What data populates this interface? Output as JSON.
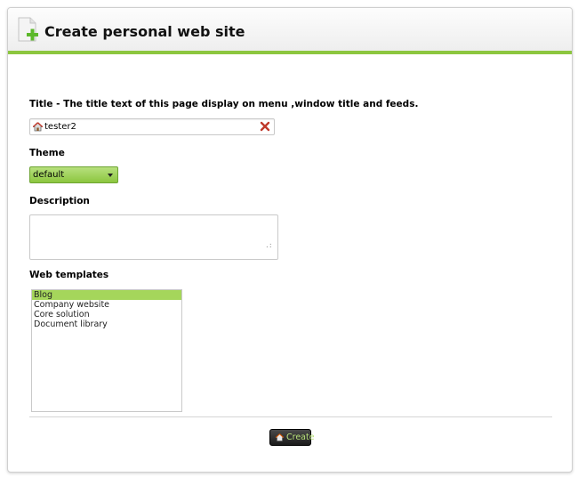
{
  "header": {
    "title": "Create personal web site",
    "icon": "document-add-icon",
    "accent": "#8cc63f"
  },
  "form": {
    "title_label": "Title - The title text of this page display on menu ,window title and feeds.",
    "title_value": "tester2",
    "theme_label": "Theme",
    "theme_selected": "default",
    "description_label": "Description",
    "description_value": "",
    "templates_label": "Web templates",
    "templates": [
      {
        "label": "Blog",
        "selected": true
      },
      {
        "label": "Company website",
        "selected": false
      },
      {
        "label": "Core solution",
        "selected": false
      },
      {
        "label": "Document library",
        "selected": false
      }
    ]
  },
  "actions": {
    "create_label": "Create",
    "create_icon": "home-icon"
  }
}
